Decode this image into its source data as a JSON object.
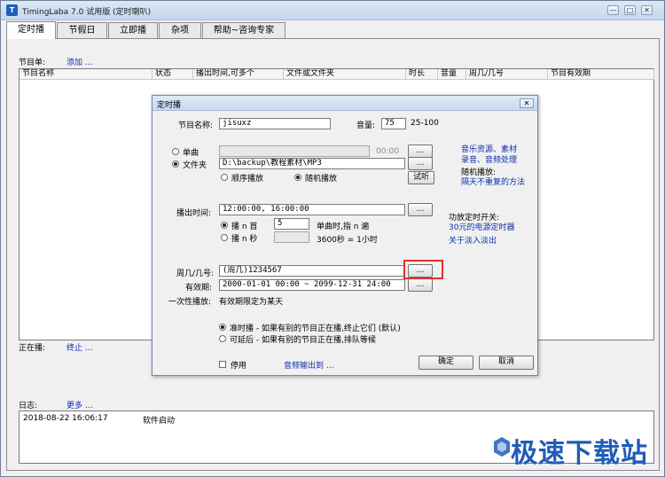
{
  "window": {
    "title": "TimingLaba 7.0 试用版 (定时喇叭)",
    "controls": [
      "—",
      "□",
      "✕"
    ]
  },
  "tabs": [
    {
      "label": "定时播",
      "active": true
    },
    {
      "label": "节假日",
      "active": false
    },
    {
      "label": "立即播",
      "active": false
    },
    {
      "label": "杂项",
      "active": false
    },
    {
      "label": "帮助~咨询专家",
      "active": false
    }
  ],
  "program_list": {
    "label": "节目单:",
    "add_link": "添加 …",
    "columns": [
      "节目名称",
      "状态",
      "播出时间,可多个",
      "文件或文件夹",
      "时长",
      "音量",
      "周几/几号",
      "节目有效期"
    ]
  },
  "playing": {
    "label": "正在播:",
    "stop_link": "终止 …"
  },
  "log": {
    "label": "日志:",
    "more_link": "更多 …",
    "entries": [
      {
        "time": "2018-08-22 16:06:17",
        "message": "软件启动"
      }
    ]
  },
  "dialog": {
    "title": "定时播",
    "close": "✕",
    "name_label": "节目名称:",
    "name_value": "jisuxz",
    "volume_label": "音量:",
    "volume_value": "75",
    "volume_range": "25-100",
    "single_label": "单曲",
    "single_value": "",
    "single_time": "00:00",
    "folder_label": "文件夹",
    "folder_value": "D:\\backup\\教程素材\\MP3",
    "order_label": "顺序播放",
    "random_label": "随机播放",
    "audition_button": "试听",
    "ellipsis": "…",
    "side_links": {
      "music_resources": "音乐资源、素材",
      "record_process": "录音、音频处理",
      "random_play_label": "随机播放:",
      "random_no_repeat": "隔天不重复的方法",
      "amp_switch_label": "功放定时开关:",
      "power_timer": "30元的电源定时器",
      "fade": "关于淡入淡出"
    },
    "airtime_label": "播出时间:",
    "airtime_value": "12:00:00, 16:00:00",
    "play_n_times_label": "播 n 首",
    "play_n_times_value": "5",
    "play_n_times_hint": "单曲时,指 n 遍",
    "play_n_seconds_label": "播 n 秒",
    "play_n_seconds_value": "",
    "play_n_seconds_hint": "3600秒 = 1小时",
    "weekday_label": "周几/几号:",
    "weekday_value": "(周几)1234567",
    "validity_label": "有效期:",
    "validity_value": "2000-01-01 00:00 ~ 2099-12-31 24:00",
    "once_label": "一次性播放:",
    "once_value": "有效期限定为某天",
    "ontime_label": "准时播 - 如果有别的节目正在播,终止它们 (默认)",
    "delay_label": "可延后 - 如果有别的节目正在播,排队等候",
    "disable_label": "停用",
    "audio_output_link": "音频输出到 …",
    "ok_button": "确定",
    "cancel_button": "取消"
  },
  "watermark": "极速下载站",
  "colors": {
    "link": "#0b2fb0",
    "highlight": "#e03030",
    "watermark": "#1f5cb8"
  }
}
